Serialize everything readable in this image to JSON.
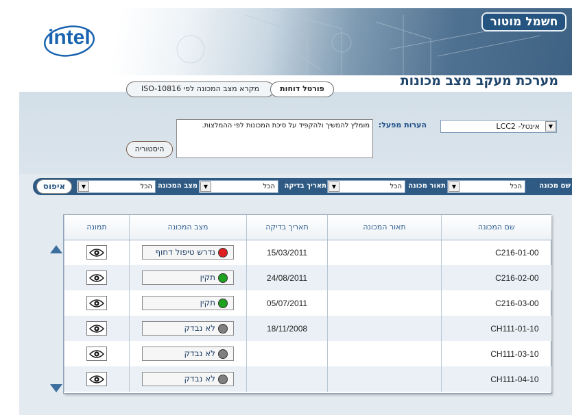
{
  "brand": {
    "tab_label": "חשמל מוטור",
    "logo_text": "intel"
  },
  "app": {
    "title": "מערכת מעקב מצב מכונות"
  },
  "tabs": [
    {
      "label": "פורטל דוחות"
    },
    {
      "label": "מקרא מצב המכונה לפי ISO-10816"
    }
  ],
  "machine_selector": {
    "value": "אינטל- LCC2"
  },
  "notes": {
    "label": "הערות מפעל:",
    "text": "מומלץ להמשיך ולהקפיד על סיכת המכונות לפי ההמלצות."
  },
  "history_button": {
    "label": "היסטוריה"
  },
  "filters": {
    "machine_name": {
      "label": "שם מכונה",
      "value": "הכל"
    },
    "machine_desc": {
      "label": "תאור מכונה",
      "value": "הכל"
    },
    "check_date": {
      "label": "תאריך בדיקה",
      "value": "הכל"
    },
    "machine_state": {
      "label": "מצב המכונה",
      "value": "הכל"
    },
    "last": {
      "value": "הכל"
    },
    "reset_label": "איפוס"
  },
  "table": {
    "headers": {
      "name": "שם המכונה",
      "desc": "תאור המכונה",
      "date": "תאריך בדיקה",
      "state": "מצב המכונה",
      "image": "תמונה"
    },
    "rows": [
      {
        "name": "C216-01-00",
        "desc": "",
        "date": "15/03/2011",
        "state": "נדרש טיפול דחוף",
        "state_color": "#e02020"
      },
      {
        "name": "C216-02-00",
        "desc": "",
        "date": "24/08/2011",
        "state": "תקין",
        "state_color": "#1fa21f"
      },
      {
        "name": "C216-03-00",
        "desc": "",
        "date": "05/07/2011",
        "state": "תקין",
        "state_color": "#1fa21f"
      },
      {
        "name": "CH111-01-10",
        "desc": "",
        "date": "18/11/2008",
        "state": "לא נבדק",
        "state_color": "#808080"
      },
      {
        "name": "CH111-03-10",
        "desc": "",
        "date": "",
        "state": "לא נבדק",
        "state_color": "#808080"
      },
      {
        "name": "CH111-04-10",
        "desc": "",
        "date": "",
        "state": "לא נבדק",
        "state_color": "#808080"
      }
    ]
  },
  "colors": {
    "accent": "#2e5a84",
    "title": "#1e4569",
    "panel": "#e3eaf0"
  },
  "icons": {
    "view": "eye-icon",
    "scroll_up": "triangle-up-icon",
    "scroll_down": "triangle-down-icon",
    "dropdown": "chevron-down-icon"
  }
}
